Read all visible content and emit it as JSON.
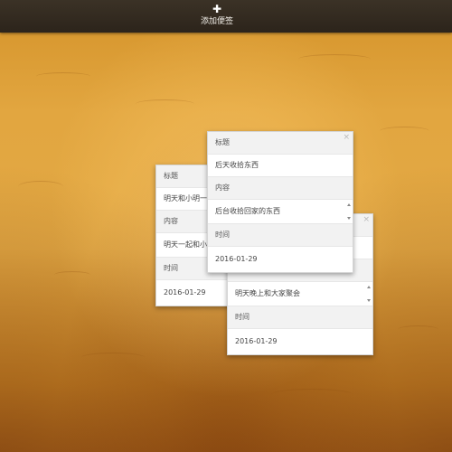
{
  "toolbar": {
    "add_icon": "plus-icon",
    "add_label": "添加便签"
  },
  "labels": {
    "title": "标题",
    "content": "内容",
    "time": "时间",
    "close": "×"
  },
  "notes": [
    {
      "title": "明天和小明一起",
      "content": "明天一起和小明",
      "time": "2016-01-29"
    },
    {
      "title": "",
      "content": "明天晚上和大家聚会",
      "time": "2016-01-29"
    },
    {
      "title": "后天收拾东西",
      "content": "后台收拾回家的东西",
      "time": "2016-01-29"
    }
  ],
  "colors": {
    "topbar": "#2f271e",
    "background": "#e2a640",
    "note_header": "#f2f2f2"
  }
}
